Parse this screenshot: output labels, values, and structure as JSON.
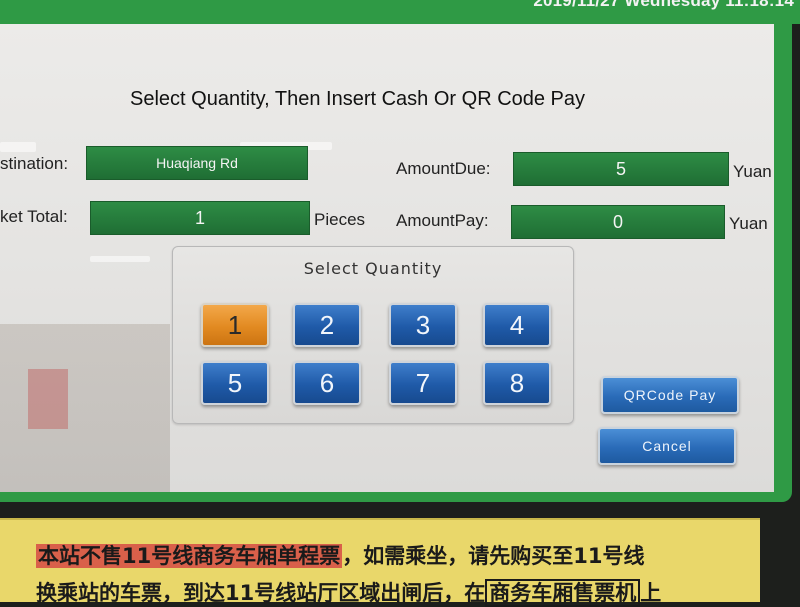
{
  "status_bar": {
    "datetime": "2019/11/27 Wednesday 11:18:14"
  },
  "headline": "Select Quantity, Then Insert Cash Or QR Code Pay",
  "destination": {
    "label": "stination:",
    "value": "Huaqiang Rd"
  },
  "ticket_total": {
    "label": "ket Total:",
    "value": "1",
    "unit": "Pieces"
  },
  "amount_due": {
    "label": "AmountDue:",
    "value": "5",
    "unit": "Yuan"
  },
  "amount_pay": {
    "label": "AmountPay:",
    "value": "0",
    "unit": "Yuan"
  },
  "quantity_panel": {
    "title": "Select Quantity",
    "buttons": [
      "1",
      "2",
      "3",
      "4",
      "5",
      "6",
      "7",
      "8"
    ],
    "selected": "1"
  },
  "actions": {
    "qr_pay": "QRCode Pay",
    "cancel": "Cancel"
  },
  "colors": {
    "accent_green": "#2f9a45",
    "field_green": "#1f6e34",
    "button_blue": "#1f5aa8",
    "selected_orange": "#e28a21"
  },
  "notice": {
    "line1_highlight": "本站不售11号线商务车厢单程票",
    "line1_rest": "，如需乘坐，请先购买至11号线",
    "line2_prefix": "换乘站的车票，到达11号线站厅区域出闸后，在",
    "line2_boxed": "商务车厢售票机",
    "line2_suffix": "上"
  }
}
